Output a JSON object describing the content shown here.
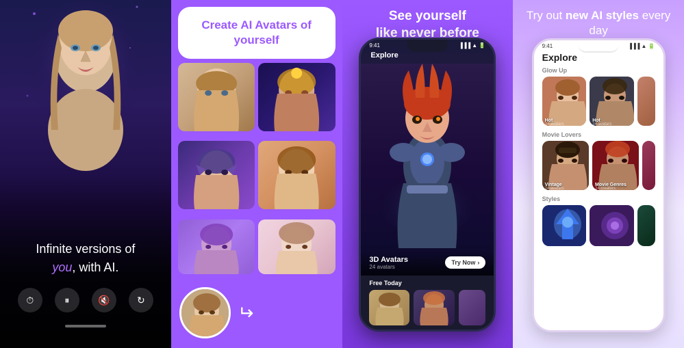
{
  "panels": {
    "panel1": {
      "bottom_text_line1": "Infinite versions of",
      "bottom_text_line2": "you",
      "bottom_text_sep": ", with ",
      "bottom_text_line3": "AI.",
      "controls": [
        "timer",
        "pause",
        "volume",
        "rotate"
      ]
    },
    "panel2": {
      "title": "Create AI Avatars of yourself",
      "title_highlight_words": [
        "AI",
        "Avatars"
      ],
      "bg_color": "#9b59ff"
    },
    "panel3": {
      "title": "See yourself\nlike never before",
      "explore_label": "Explore",
      "hero_card_title": "3D Avatars",
      "hero_card_count": "24 avatars",
      "hero_cta": "Try Now",
      "free_today": "Free Today",
      "status_time": "9:41"
    },
    "panel4": {
      "title_line1": "Try out",
      "title_bold": "new AI styles",
      "title_line2": "every day",
      "explore_label": "Explore",
      "section1_label": "Glow Up",
      "card1_label": "Hot",
      "card1_count": "24 avatars",
      "card2_label": "Hot",
      "card2_count": "24 avatars",
      "section2_label": "Movie Lovers",
      "card3_label": "Vintage",
      "card3_count": "24 avatars",
      "card4_label": "Movie Genres",
      "card4_count": "24 creators",
      "section3_label": "Styles",
      "status_time": "9:41"
    }
  }
}
